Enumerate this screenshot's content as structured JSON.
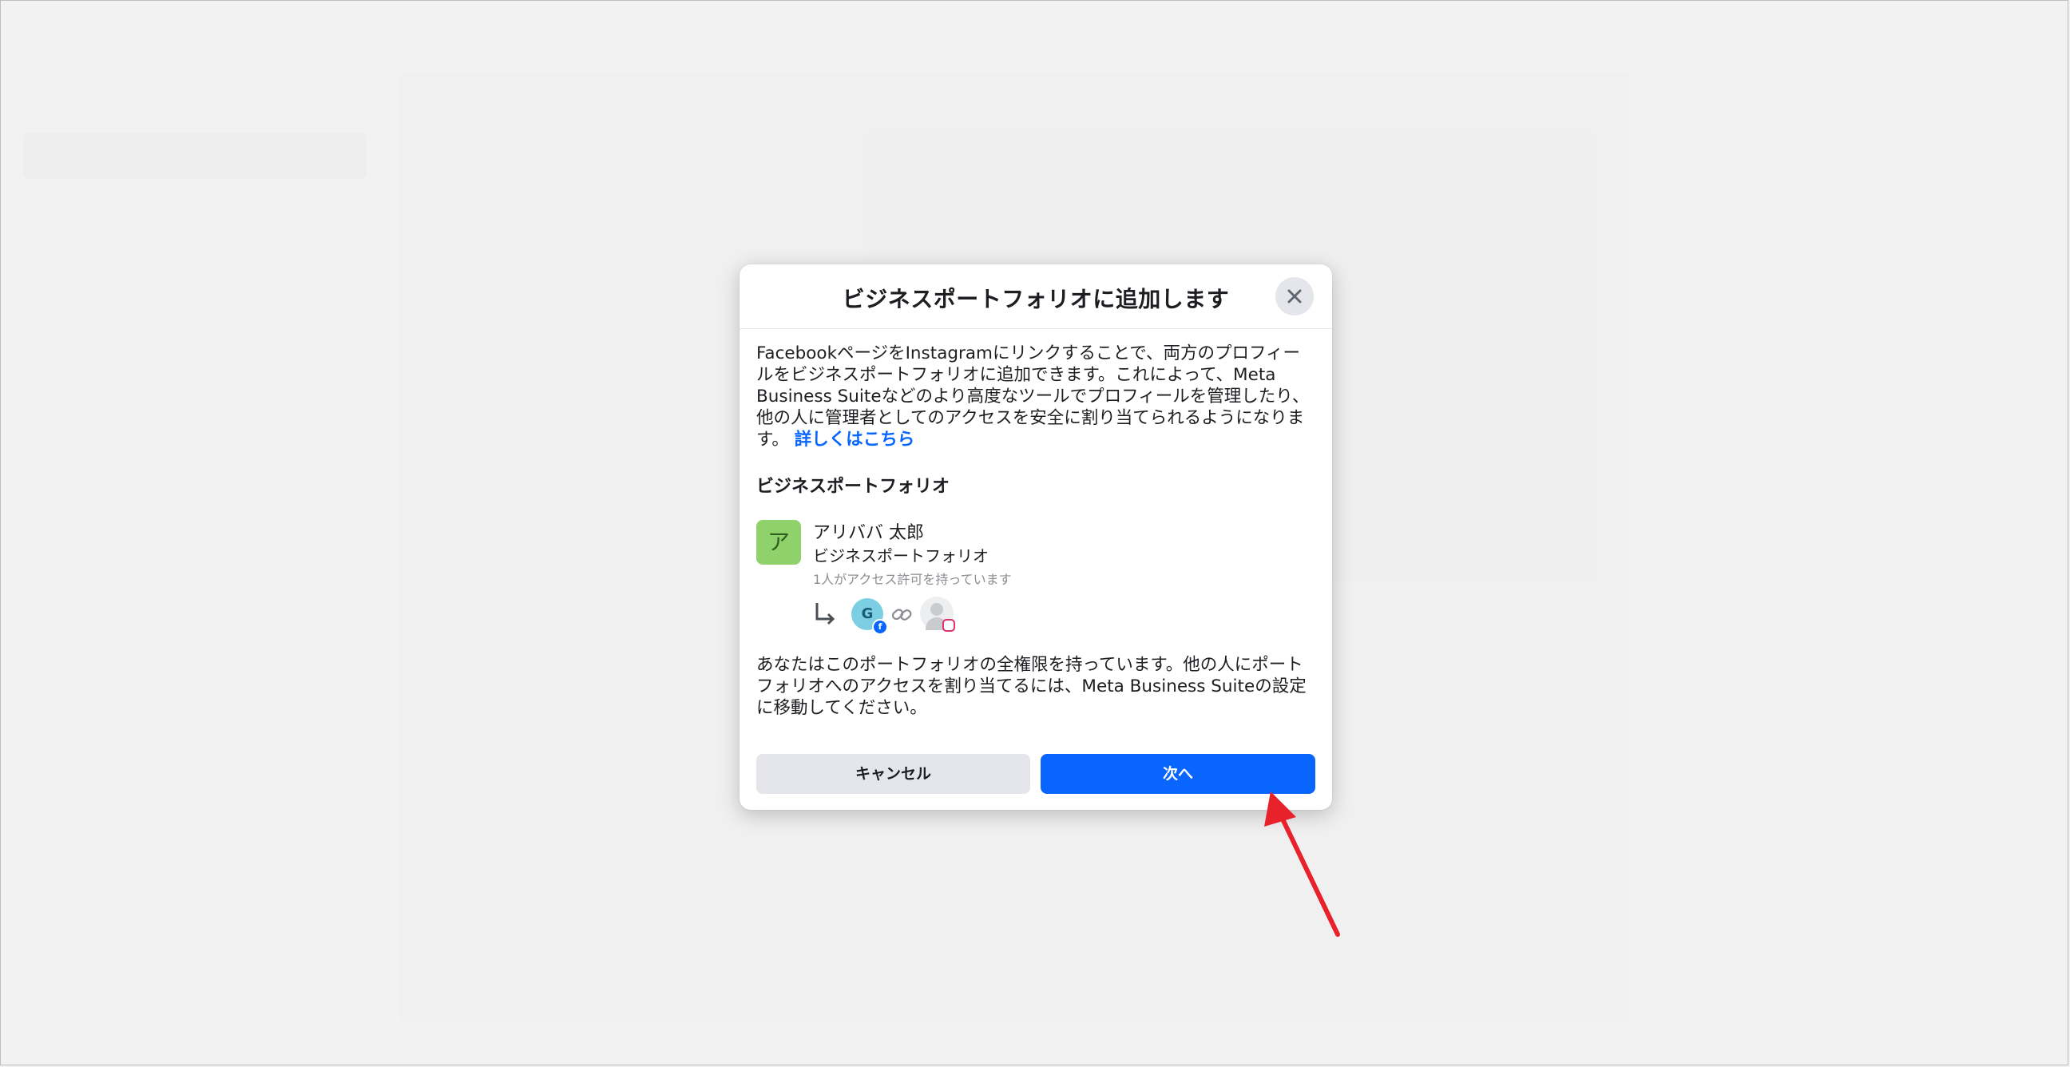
{
  "dialog": {
    "title": "ビジネスポートフォリオに追加します",
    "description": "FacebookページをInstagramにリンクすることで、両方のプロフィールをビジネスポートフォリオに追加できます。これによって、Meta Business Suiteなどのより高度なツールでプロフィールを管理したり、他の人に管理者としてのアクセスを安全に割り当てられるようになります。",
    "learn_more_link": "詳しくはこちら",
    "section_heading": "ビジネスポートフォリオ",
    "portfolio": {
      "avatar_letter": "ア",
      "name": "アリババ 太郎",
      "type": "ビジネスポートフォリオ",
      "access_info": "1人がアクセス許可を持っています",
      "facebook_asset_initial": "G"
    },
    "footer_text": "あなたはこのポートフォリオの全権限を持っています。他の人にポートフォリオへのアクセスを割り当てるには、Meta Business Suiteの設定に移動してください。",
    "cancel_button": "キャンセル",
    "next_button": "次へ"
  },
  "icons": {
    "close": "close-icon",
    "branch": "branch-arrow-icon",
    "link": "link-icon",
    "facebook_badge": "facebook-badge-icon",
    "instagram_badge": "instagram-badge-icon",
    "annotation_arrow": "red-arrow-icon"
  },
  "colors": {
    "primary_button": "#0866ff",
    "link": "#0866ff",
    "secondary_button": "#e4e6eb",
    "avatar": "#8fd16a",
    "annotation": "#e8222b"
  }
}
